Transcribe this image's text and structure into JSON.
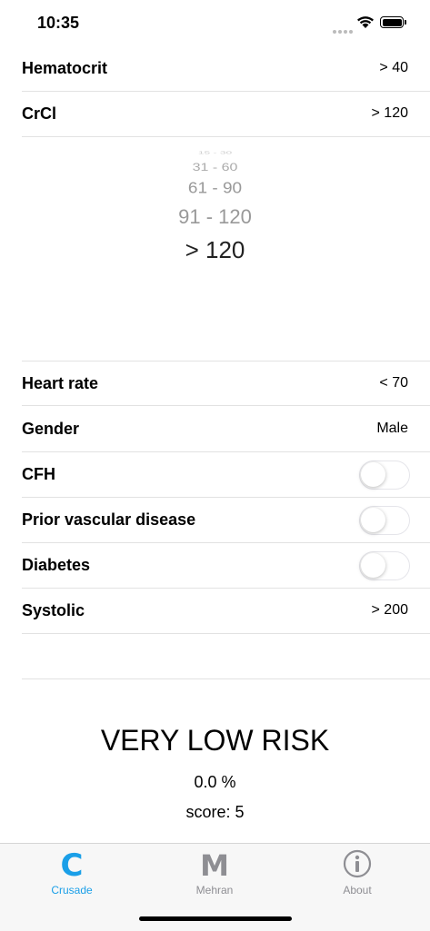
{
  "status": {
    "time": "10:35"
  },
  "rows_top": [
    {
      "label": "Hematocrit",
      "value": "> 40"
    },
    {
      "label": "CrCl",
      "value": "> 120"
    }
  ],
  "picker": {
    "options": [
      "15 - 30",
      "31 - 60",
      "61 - 90",
      "91 - 120",
      "> 120"
    ],
    "selected": "> 120"
  },
  "rows_bottom": [
    {
      "label": "Heart rate",
      "value": "< 70"
    },
    {
      "label": "Gender",
      "value": "Male"
    },
    {
      "label": "CFH",
      "toggle": false
    },
    {
      "label": "Prior vascular disease",
      "toggle": false
    },
    {
      "label": "Diabetes",
      "toggle": false
    },
    {
      "label": "Systolic",
      "value": "> 200"
    }
  ],
  "result": {
    "risk": "VERY LOW RISK",
    "percent": "0.0 %",
    "score": "score: 5"
  },
  "tabs": [
    {
      "label": "Crusade",
      "glyph": "C",
      "active": true
    },
    {
      "label": "Mehran",
      "glyph": "M",
      "active": false
    },
    {
      "label": "About",
      "glyph": "i",
      "active": false
    }
  ],
  "colors": {
    "accent": "#1A9FE8",
    "inactive": "#8E8E93"
  }
}
